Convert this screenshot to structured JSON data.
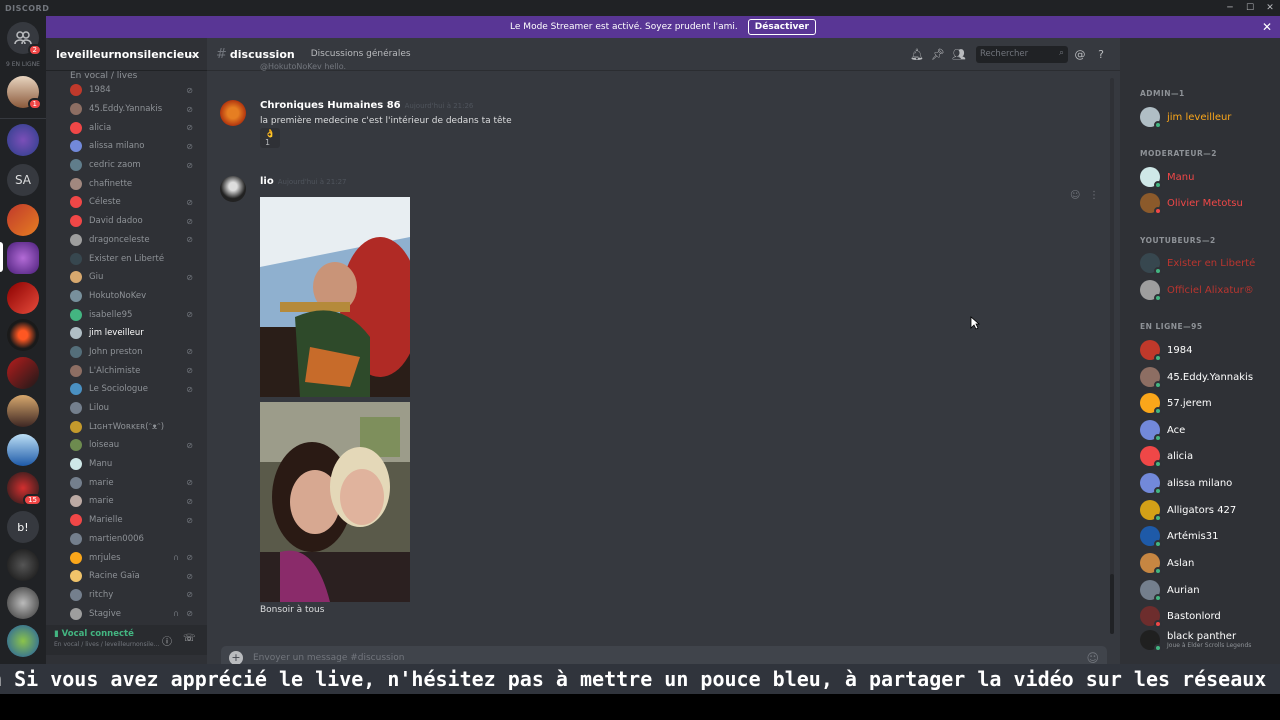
{
  "app": {
    "title": "DISCORD"
  },
  "window": {
    "minimize": "─",
    "maximize": "☐",
    "close": "✕"
  },
  "streamer": {
    "text": "Le Mode Streamer est activé. Soyez prudent l'ami.",
    "button": "Désactiver",
    "close": "✕"
  },
  "guilds": {
    "online": "9 EN LIGNE",
    "badge_home": "2",
    "badge_user": "1",
    "badge_15": "15",
    "sa": "SA",
    "b": "b!"
  },
  "server": {
    "name": "leveilleurnonsilencieux",
    "chevron": "⌄"
  },
  "voice_channel": {
    "name": "En vocal / lives"
  },
  "voice_users": [
    {
      "name": "1984",
      "color": "#c0392b",
      "muted": true,
      "deaf": false
    },
    {
      "name": "45.Eddy.Yannakis",
      "color": "#8d6e63",
      "muted": true,
      "deaf": false
    },
    {
      "name": "alicia",
      "color": "#f04747",
      "muted": true,
      "deaf": false
    },
    {
      "name": "alissa milano",
      "color": "#7289da",
      "muted": true,
      "deaf": false
    },
    {
      "name": "cedric zaom",
      "color": "#607d8b",
      "muted": true,
      "deaf": false
    },
    {
      "name": "chafinette",
      "color": "#a1887f",
      "muted": false,
      "deaf": false
    },
    {
      "name": "Céleste",
      "color": "#f04747",
      "muted": true,
      "deaf": false
    },
    {
      "name": "David dadoo",
      "color": "#f04747",
      "muted": true,
      "deaf": false
    },
    {
      "name": "dragonceleste",
      "color": "#9e9e9e",
      "muted": true,
      "deaf": false
    },
    {
      "name": "Exister en Liberté",
      "color": "#37474f",
      "muted": false,
      "deaf": false
    },
    {
      "name": "Giu",
      "color": "#d7a86e",
      "muted": true,
      "deaf": false
    },
    {
      "name": "HokutoNoKev",
      "color": "#78909c",
      "muted": false,
      "deaf": false
    },
    {
      "name": "isabelle95",
      "color": "#43b581",
      "muted": true,
      "deaf": false
    },
    {
      "name": "jim leveilleur",
      "color": "#b0bec5",
      "muted": false,
      "deaf": false,
      "active": true
    },
    {
      "name": "John preston",
      "color": "#546e7a",
      "muted": true,
      "deaf": false
    },
    {
      "name": "L'Alchimiste",
      "color": "#8d6e63",
      "muted": true,
      "deaf": false
    },
    {
      "name": "Le Sociologue",
      "color": "#4a90c2",
      "muted": true,
      "deaf": false
    },
    {
      "name": "Lilou",
      "color": "#747f8d",
      "muted": false,
      "deaf": false
    },
    {
      "name": "LɪɢʜтWoʀĸᴇʀ(ᵔᴥᵔ)",
      "color": "#c49a2c",
      "muted": false,
      "deaf": false
    },
    {
      "name": "loiseau",
      "color": "#6d8b4f",
      "muted": true,
      "deaf": false
    },
    {
      "name": "Manu",
      "color": "#cfe8e8",
      "muted": false,
      "deaf": false
    },
    {
      "name": "marie",
      "color": "#747f8d",
      "muted": true,
      "deaf": false
    },
    {
      "name": "marie",
      "color": "#bcaaa4",
      "muted": true,
      "deaf": false
    },
    {
      "name": "Marielle",
      "color": "#f04747",
      "muted": true,
      "deaf": false
    },
    {
      "name": "martien0006",
      "color": "#747f8d",
      "muted": false,
      "deaf": false
    },
    {
      "name": "mrjules",
      "color": "#faa61a",
      "muted": true,
      "deaf": true
    },
    {
      "name": "Racine Gaïa",
      "color": "#f0c36a",
      "muted": true,
      "deaf": false
    },
    {
      "name": "ritchy",
      "color": "#747f8d",
      "muted": true,
      "deaf": false
    },
    {
      "name": "Stagive",
      "color": "#9e9e9e",
      "muted": true,
      "deaf": true
    }
  ],
  "voice_status": {
    "title": "Vocal connecté",
    "sub": "En vocal / lives / leveilleurnonsile..."
  },
  "channel": {
    "hash": "#",
    "name": "discussion",
    "topic": "Discussions générales"
  },
  "search": {
    "placeholder": "Rechercher"
  },
  "messages": [
    {
      "author": "",
      "text": "@HokutoNoKev hello."
    },
    {
      "author": "Chroniques Humaines 86",
      "time": "Aujourd'hui à 21:26",
      "text": "la première medecine c'est l'intérieur de dedans ta tête",
      "reaction": "👌 1"
    },
    {
      "author": "lio",
      "time": "Aujourd'hui à 21:27",
      "text": "Bonsoir à tous"
    }
  ],
  "composer": {
    "placeholder": "Envoyer un message #discussion"
  },
  "member_sections": [
    {
      "header": "ADMIN—1"
    },
    {
      "header": "MODERATEUR—2"
    },
    {
      "header": "YOUTUBEURS—2"
    },
    {
      "header": "EN LIGNE—95"
    }
  ],
  "members": [
    {
      "name": "jim leveilleur",
      "color": "#faa61a",
      "avatar": "#b0bec5",
      "status": "#43b581"
    },
    {
      "name": "Manu",
      "color": "#f04747",
      "avatar": "#cfe8e8",
      "status": "#43b581"
    },
    {
      "name": "Olivier Metotsu",
      "color": "#f04747",
      "avatar": "#8b5a2b",
      "status": "#f04747"
    },
    {
      "name": "Exister en Liberté",
      "color": "#b9352f",
      "avatar": "#37474f",
      "status": "#43b581"
    },
    {
      "name": "Officiel Alixatur®",
      "color": "#b9352f",
      "avatar": "#9e9e9e",
      "status": "#43b581"
    },
    {
      "name": "1984",
      "color": "#ffffff",
      "avatar": "#c0392b",
      "status": "#43b581"
    },
    {
      "name": "45.Eddy.Yannakis",
      "color": "#ffffff",
      "avatar": "#8d6e63",
      "status": "#43b581"
    },
    {
      "name": "57.jerem",
      "color": "#ffffff",
      "avatar": "#faa61a",
      "status": "#43b581"
    },
    {
      "name": "Ace",
      "color": "#ffffff",
      "avatar": "#7289da",
      "status": "#43b581"
    },
    {
      "name": "alicia",
      "color": "#ffffff",
      "avatar": "#f04747",
      "status": "#43b581"
    },
    {
      "name": "alissa milano",
      "color": "#ffffff",
      "avatar": "#7289da",
      "status": "#43b581"
    },
    {
      "name": "Alligators 427",
      "color": "#ffffff",
      "avatar": "#d4a017",
      "status": "#43b581"
    },
    {
      "name": "Artémis31",
      "color": "#ffffff",
      "avatar": "#1e5aa8",
      "status": "#43b581"
    },
    {
      "name": "Aslan",
      "color": "#ffffff",
      "avatar": "#c68642",
      "status": "#43b581"
    },
    {
      "name": "Aurian",
      "color": "#ffffff",
      "avatar": "#747f8d",
      "status": "#43b581"
    },
    {
      "name": "Bastonlord",
      "color": "#ffffff",
      "avatar": "#6d2d2d",
      "status": "#f04747"
    },
    {
      "name": "black panther",
      "color": "#ffffff",
      "avatar": "#202020",
      "status": "#43b581",
      "sub": "Joue à Elder Scrolls Legends"
    }
  ],
  "subtitle": {
    "text": "n Si vous avez apprécié le live, n'hésitez pas à mettre un pouce bleu, à partager la vidéo sur les réseaux sociaux, et"
  }
}
